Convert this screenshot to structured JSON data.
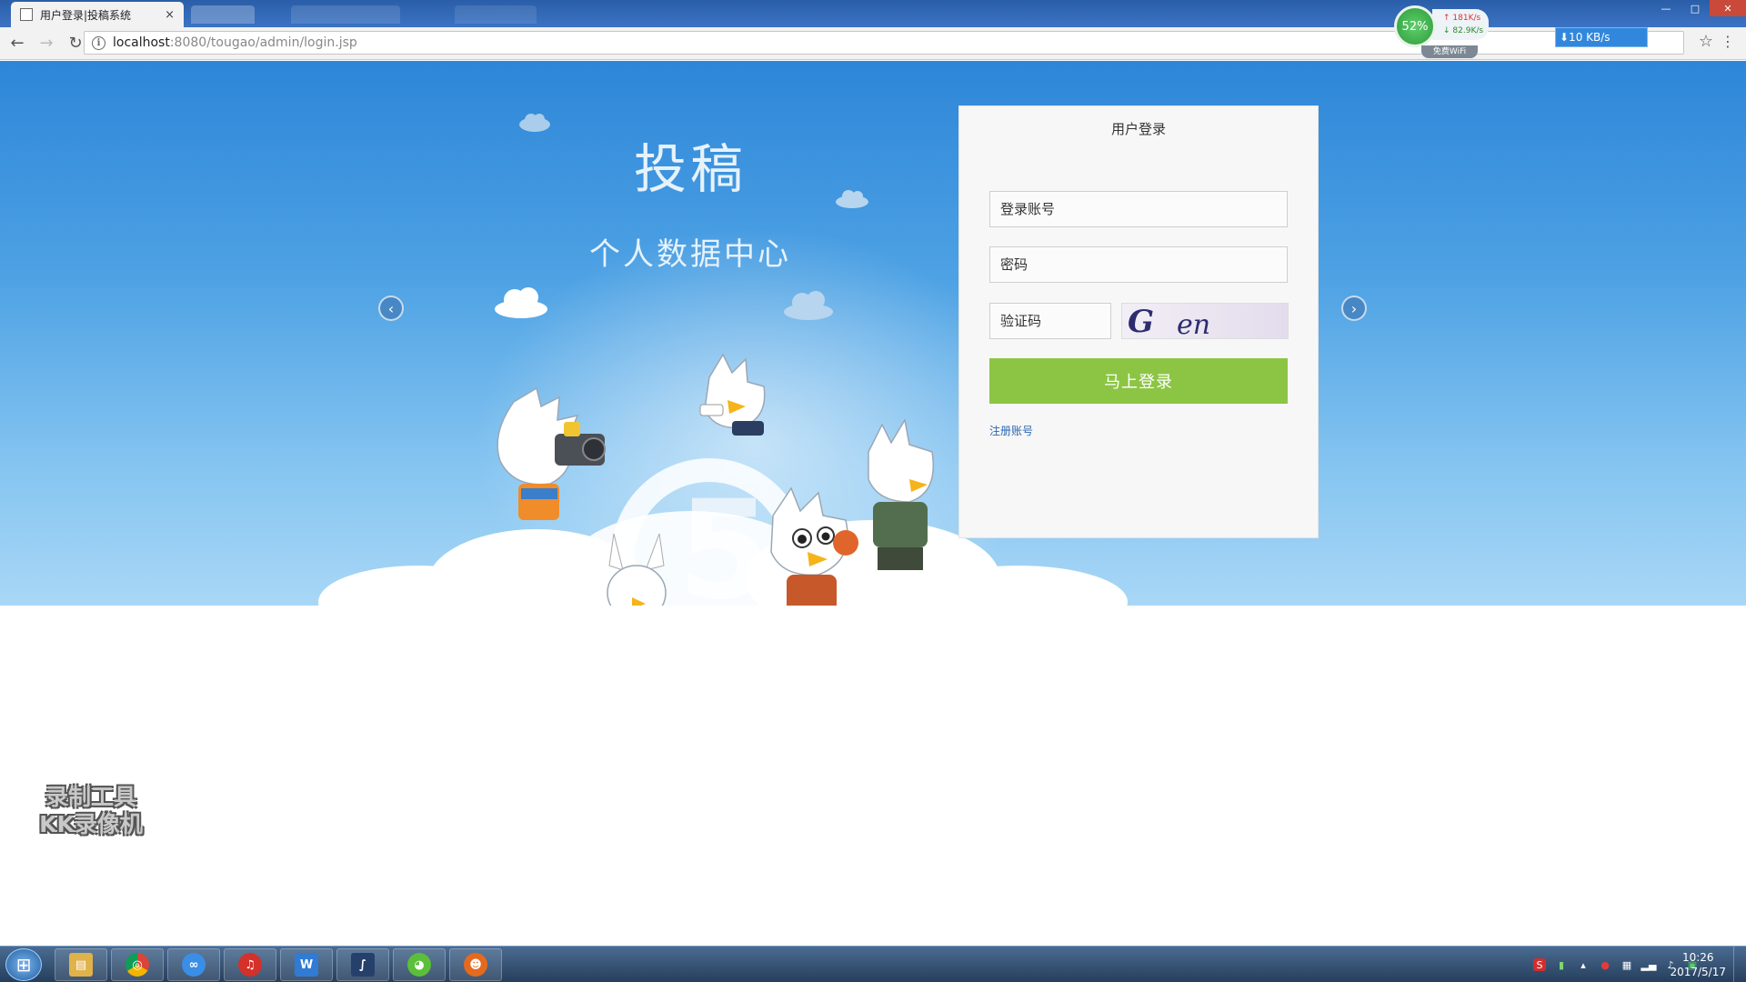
{
  "browser": {
    "tab_title": "用户登录|投稿系统",
    "tab_close": "×",
    "url_host": "localhost",
    "url_path": ":8080/tougao/admin/login.jsp",
    "info_glyph": "i",
    "back_glyph": "←",
    "forward_glyph": "→",
    "reload_glyph": "↻",
    "bookmark_glyph": "☆",
    "menu_glyph": "⋮"
  },
  "window_controls": {
    "minimize": "—",
    "maximize": "□",
    "close": "✕"
  },
  "net_widget": {
    "percent": "52%",
    "up": "↑ 181K/s",
    "down": "↓ 82.9K/s",
    "wifi": "免费WiFi"
  },
  "cloud_speed": {
    "text": "⬇10 KB/s"
  },
  "banner": {
    "headline": "投稿",
    "subline": "个人数据中心",
    "prev_arrow": "‹",
    "next_arrow": "›"
  },
  "login": {
    "title": "用户登录",
    "username_placeholder": "登录账号",
    "password_placeholder": "密码",
    "captcha_placeholder": "验证码",
    "captcha_text_1": "G",
    "captcha_text_2": "en",
    "submit_label": "马上登录",
    "register_label": "注册账号",
    "button_color": "#8cc544"
  },
  "watermark": {
    "line1": "录制工具",
    "line2": "KK录像机"
  },
  "taskbar": {
    "start_glyph": "⊞",
    "apps": [
      {
        "name": "file-explorer",
        "glyph": "▤"
      },
      {
        "name": "chrome",
        "glyph": "◎"
      },
      {
        "name": "baidu-netdisk",
        "glyph": "∞"
      },
      {
        "name": "netease-music",
        "glyph": "♫"
      },
      {
        "name": "wps-writer",
        "glyph": "W"
      },
      {
        "name": "feather-app",
        "glyph": "∫"
      },
      {
        "name": "green-app",
        "glyph": "◕"
      },
      {
        "name": "avatar-app",
        "glyph": "☻"
      }
    ],
    "tray_glyphs": [
      "S",
      "▮",
      "▴",
      "●",
      "▦",
      "▂▄",
      "♪",
      "▣"
    ],
    "clock_time": "10:26",
    "clock_date": "2017/5/17"
  }
}
